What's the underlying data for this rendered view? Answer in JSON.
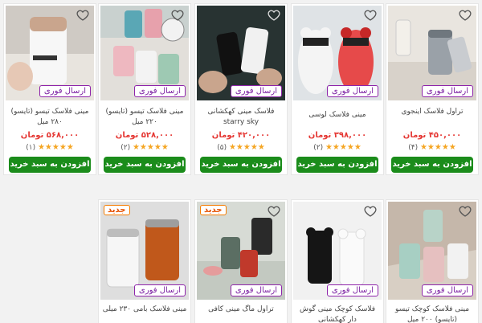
{
  "labels": {
    "fast_delivery": "ارسال فوری",
    "new": "جدید",
    "add_to_cart": "افزودن به سبد خرید",
    "currency": "تومان"
  },
  "products_row1": [
    {
      "title": "مینی فلاسک تیسو (تایسو) ۲۸۰ میل",
      "price": "۵۶۸,۰۰۰",
      "stars": "★★★★★",
      "reviews": "(۱)",
      "image": "white-mug-tyeso"
    },
    {
      "title": "مینی فلاسک تیسو (تایسو) ۲۲۰ میل",
      "price": "۵۲۸,۰۰۰",
      "stars": "★★★★★",
      "reviews": "(۲)",
      "image": "pastel-mugs-tyeso"
    },
    {
      "title": "فلاسک مینی کهکشانی starry sky",
      "price": "۴۲۰,۰۰۰",
      "stars": "★★★★★",
      "reviews": "(۵)",
      "image": "starry-flasks"
    },
    {
      "title": "مینی فلاسک لوسی",
      "price": "۳۹۸,۰۰۰",
      "stars": "★★★★★",
      "reviews": "(۲)",
      "image": "bear-flasks"
    },
    {
      "title": "تراول فلاسک اینجوی",
      "price": "۴۵۰,۰۰۰",
      "stars": "★★★★★",
      "reviews": "(۴)",
      "image": "grey-travel-flask"
    }
  ],
  "products_row2": [
    {
      "title": "مینی فلاسک کوچک تیسو (تایسو) ۲۰۰ میل",
      "image": "pastel-small-flasks",
      "is_new": false
    },
    {
      "title": "فلاسک کوچک مینی گوش دار کهکشانی",
      "image": "black-white-ear-flasks",
      "is_new": false
    },
    {
      "title": "تراول ماگ مینی کافی",
      "image": "coffee-mini-mugs",
      "is_new": true
    },
    {
      "title": "مینی فلاسک بامی ۲۳۰ میلی",
      "image": "white-orange-mugs",
      "is_new": true
    }
  ],
  "colors": {
    "fast": "#8e24aa",
    "price": "#e53935",
    "button": "#1b8c1b",
    "star": "#f5a623",
    "new": "#f57c00"
  }
}
